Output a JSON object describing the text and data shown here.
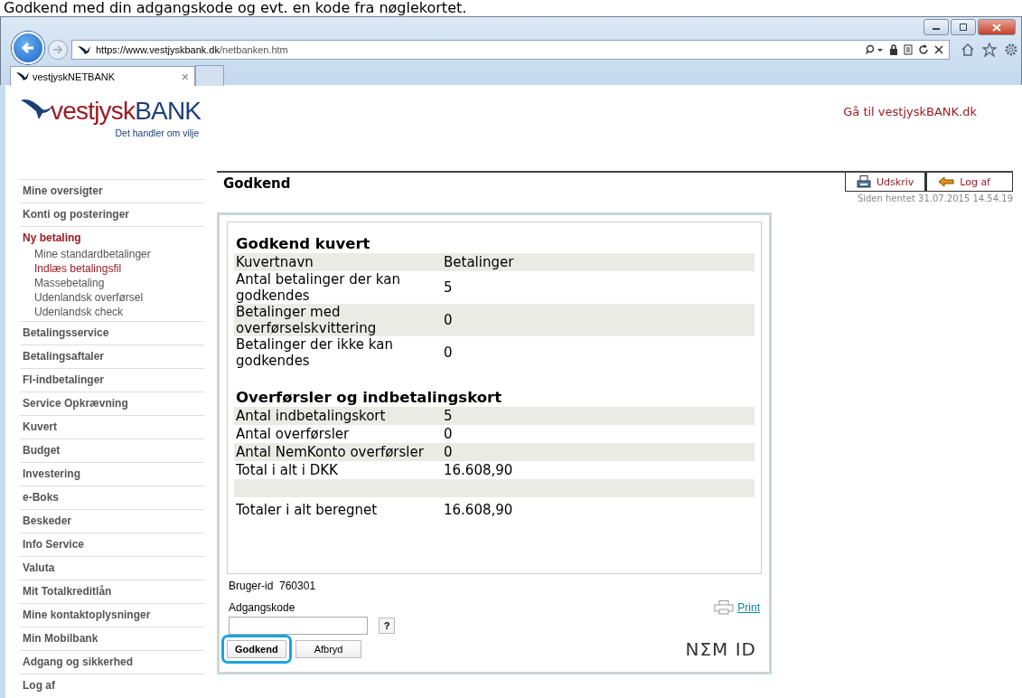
{
  "caption": "Godkend med din adgangskode og evt. en kode fra nøglekortet.",
  "browser": {
    "url_host": "https://www.vestjyskbank.dk",
    "url_path": "/netbanken.htm",
    "tab": {
      "title": "vestjyskNETBANK",
      "close": "×",
      "selected": true
    }
  },
  "header": {
    "logo_name": "vestjysk",
    "logo_bank": "BANK",
    "tagline": "Det handler om vilje",
    "link": "Gå til vestjyskBANK.dk"
  },
  "sidebar": {
    "items": [
      {
        "label": "Mine oversigter",
        "selected": false
      },
      {
        "label": "Konti og posteringer",
        "selected": false
      },
      {
        "label": "Ny betaling",
        "selected": true,
        "children": [
          {
            "label": "Mine standardbetalinger",
            "selected": false
          },
          {
            "label": "Indlæs betalingsfil",
            "selected": true
          },
          {
            "label": "Massebetaling",
            "selected": false
          },
          {
            "label": "Udenlandsk overførsel",
            "selected": false
          },
          {
            "label": "Udenlandsk check",
            "selected": false
          }
        ]
      },
      {
        "label": "Betalingsservice",
        "selected": false
      },
      {
        "label": "Betalingsaftaler",
        "selected": false
      },
      {
        "label": "FI-indbetalinger",
        "selected": false
      },
      {
        "label": "Service Opkrævning",
        "selected": false
      },
      {
        "label": "Kuvert",
        "selected": false
      },
      {
        "label": "Budget",
        "selected": false
      },
      {
        "label": "Investering",
        "selected": false
      },
      {
        "label": "e-Boks",
        "selected": false
      },
      {
        "label": "Beskeder",
        "selected": false
      },
      {
        "label": "Info Service",
        "selected": false
      },
      {
        "label": "Valuta",
        "selected": false
      },
      {
        "label": "Mit Totalkreditlån",
        "selected": false
      },
      {
        "label": "Mine kontaktoplysninger",
        "selected": false
      },
      {
        "label": "Min Mobilbank",
        "selected": false
      },
      {
        "label": "Adgang og sikkerhed",
        "selected": false
      },
      {
        "label": "Log af",
        "selected": false
      }
    ]
  },
  "page": {
    "title": "Godkend",
    "actions": [
      {
        "kind": "print",
        "label": "Udskriv"
      },
      {
        "kind": "logout",
        "label": "Log af"
      }
    ],
    "fetched": "Siden hentet 31.07.2015 14.54.19"
  },
  "sections": [
    {
      "title": "Godkend kuvert",
      "rows": [
        {
          "label": "Kuvertnavn",
          "value": "Betalinger"
        },
        {
          "label": "Antal betalinger der kan godkendes",
          "value": "5"
        },
        {
          "label": "Betalinger med overførselskvittering",
          "value": "0"
        },
        {
          "label": "Betalinger der ikke kan godkendes",
          "value": "0"
        }
      ]
    },
    {
      "title": "Overførsler og indbetalingskort",
      "rows": [
        {
          "label": "Antal indbetalingskort",
          "value": "5"
        },
        {
          "label": "Antal overførsler",
          "value": "0"
        },
        {
          "label": "Antal NemKonto overførsler",
          "value": "0"
        },
        {
          "label": "Total i alt i DKK",
          "value": "16.608,90"
        }
      ],
      "summary": [
        {
          "label": "Totaler i alt beregnet",
          "value": "16.608,90"
        }
      ]
    }
  ],
  "form": {
    "print_link": "Print",
    "user_label": "Bruger-id",
    "user_id": "760301",
    "password_label": "Adgangskode",
    "help": "?",
    "buttons": [
      {
        "label": "Godkend",
        "highlighted": true
      },
      {
        "label": "Afbryd",
        "highlighted": false
      }
    ],
    "brand": "NΣM ID"
  }
}
